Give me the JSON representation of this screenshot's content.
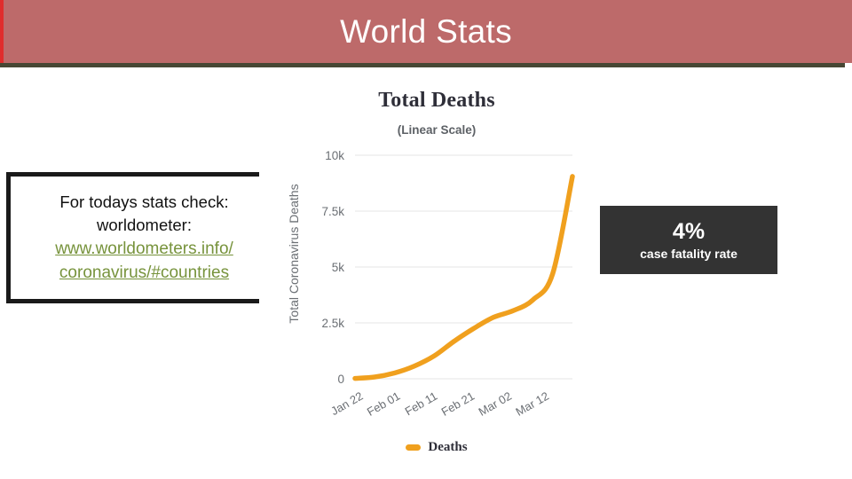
{
  "banner": {
    "title": "World Stats",
    "background_color": "#bd6a6a",
    "accent_color": "#e02c2c",
    "rule_color": "#474734"
  },
  "info_box": {
    "line1": "For todays stats check:",
    "line2": "worldometer:",
    "link_line1": "www.worldometers.info/",
    "link_line2": "coronavirus/#countries",
    "link_color": "#77933c"
  },
  "stat_box": {
    "value": "4%",
    "label": "case fatality rate",
    "background_color": "#333333"
  },
  "chart_data": {
    "type": "line",
    "title": "Total Deaths",
    "subtitle": "(Linear Scale)",
    "xlabel": "",
    "ylabel": "Total Coronavirus Deaths",
    "ylim": [
      0,
      10000
    ],
    "ytick_labels": [
      "0",
      "2.5k",
      "5k",
      "7.5k",
      "10k"
    ],
    "ytick_values": [
      0,
      2500,
      5000,
      7500,
      10000
    ],
    "xtick_labels": [
      "Jan 22",
      "Feb 01",
      "Feb 11",
      "Feb 21",
      "Mar 02",
      "Mar 12"
    ],
    "grid": true,
    "legend_position": "bottom",
    "line_color": "#f0a01e",
    "series": [
      {
        "name": "Deaths",
        "x": [
          "Jan 22",
          "Jan 27",
          "Feb 01",
          "Feb 06",
          "Feb 11",
          "Feb 16",
          "Feb 21",
          "Feb 26",
          "Mar 02",
          "Mar 07",
          "Mar 12",
          "Mar 17"
        ],
        "values": [
          17,
          80,
          259,
          565,
          1018,
          1669,
          2247,
          2747,
          3044,
          3529,
          4698,
          9050
        ]
      }
    ]
  }
}
